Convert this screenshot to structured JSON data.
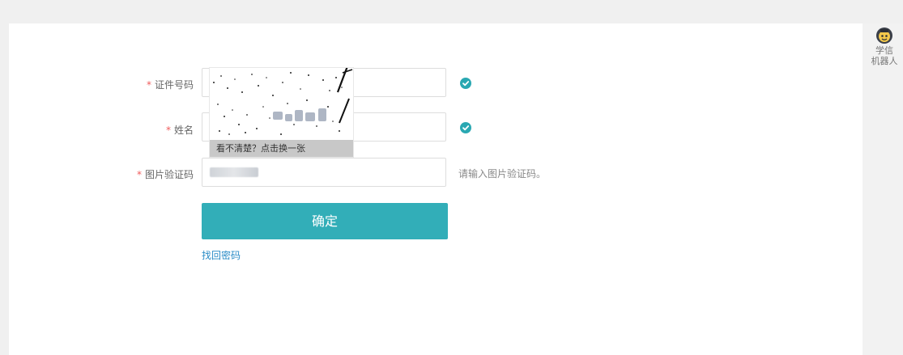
{
  "form": {
    "id_label": "证件号码",
    "name_label": "姓名",
    "captcha_label": "图片验证码",
    "required_mark": "*",
    "captcha_hint": "请输入图片验证码。",
    "confirm_label": "确定",
    "forgot_link": "找回密码"
  },
  "captcha_popup": {
    "refresh_text": "看不清楚？点击换一张"
  },
  "assistant": {
    "line1": "学信",
    "line2": "机器人",
    "icon": "robot-avatar-icon"
  },
  "colors": {
    "accent": "#32aeb8",
    "check": "#2aa8b2",
    "required": "#f05c5c",
    "link": "#2a8cc7"
  }
}
